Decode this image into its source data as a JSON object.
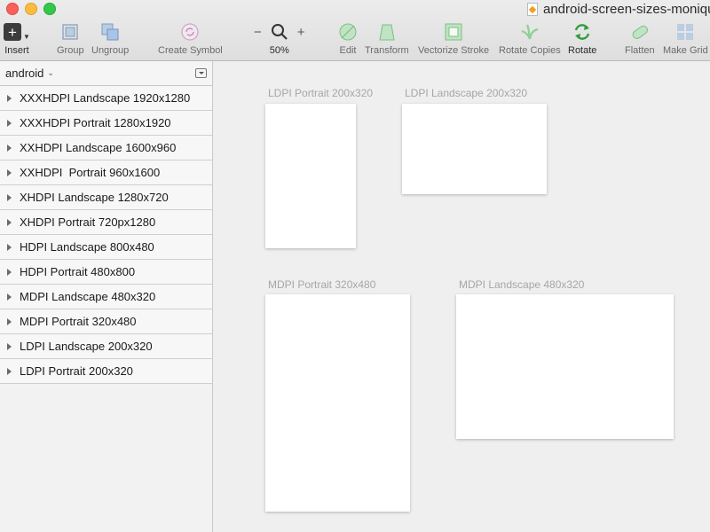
{
  "window": {
    "document_title": "android-screen-sizes-moniqu"
  },
  "toolbar": {
    "insert_label": "Insert",
    "insert_glyph": "+",
    "group_label": "Group",
    "ungroup_label": "Ungroup",
    "create_symbol_label": "Create Symbol",
    "zoom_minus": "−",
    "zoom_plus": "+",
    "zoom_value": "50%",
    "edit_label": "Edit",
    "transform_label": "Transform",
    "vectorize_stroke_label": "Vectorize Stroke",
    "rotate_copies_label": "Rotate Copies",
    "rotate_label": "Rotate",
    "flatten_label": "Flatten",
    "make_grid_label": "Make Grid",
    "icons": {
      "insert": "plus-icon",
      "group": "group-icon",
      "ungroup": "ungroup-icon",
      "create_symbol": "symbol-icon",
      "zoom": "magnifier-icon",
      "edit": "edit-shape-icon",
      "transform": "transform-icon",
      "vectorize_stroke": "vectorize-stroke-icon",
      "rotate_copies": "rotate-copies-icon",
      "rotate": "rotate-icon",
      "flatten": "flatten-icon",
      "make_grid": "grid-icon"
    }
  },
  "sidebar": {
    "page_name": "android",
    "layers": [
      {
        "label": "XXXHDPI Landscape 1920x1280"
      },
      {
        "label": "XXXHDPI Portrait 1280x1920"
      },
      {
        "label": "XXHDPI Landscape 1600x960"
      },
      {
        "label": "XXHDPI  Portrait 960x1600"
      },
      {
        "label": "XHDPI Landscape 1280x720"
      },
      {
        "label": "XHDPI Portrait 720px1280"
      },
      {
        "label": "HDPI Landscape 800x480"
      },
      {
        "label": "HDPI Portrait 480x800"
      },
      {
        "label": "MDPI Landscape 480x320"
      },
      {
        "label": "MDPI Portrait 320x480"
      },
      {
        "label": "LDPI Landscape 200x320"
      },
      {
        "label": "LDPI Portrait 200x320"
      }
    ]
  },
  "canvas": {
    "artboards": [
      {
        "label": "LDPI Portrait 200x320"
      },
      {
        "label": "LDPI Landscape 200x320"
      },
      {
        "label": "MDPI Portrait 320x480"
      },
      {
        "label": "MDPI Landscape 480x320"
      }
    ]
  },
  "colors": {
    "close": "#fc605b",
    "minimize": "#fdbc40",
    "zoom": "#34c84a",
    "accent_green": "#2e9e3a"
  }
}
